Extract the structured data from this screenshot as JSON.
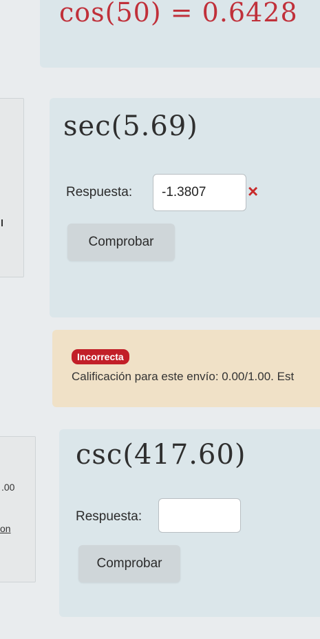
{
  "prev_question": {
    "expression": "cos(50) = 0.6428"
  },
  "question1": {
    "expression": "sec(5.69)",
    "answer_label": "Respuesta:",
    "answer_value": "-1.3807",
    "wrong_mark": "×",
    "check_button": "Comprobar"
  },
  "feedback": {
    "badge": "Incorrecta",
    "grade_text": "Calificación para este envío: 0.00/1.00. Est"
  },
  "question2": {
    "expression": "csc(417.60)",
    "answer_label": "Respuesta:",
    "answer_value": "",
    "check_button": "Comprobar",
    "side_fragment_1": ".00",
    "side_fragment_2": "on"
  },
  "colors": {
    "question_bg": "#dbe6ea",
    "feedback_bg": "#f0e1c7",
    "incorrect": "#c21f28"
  }
}
